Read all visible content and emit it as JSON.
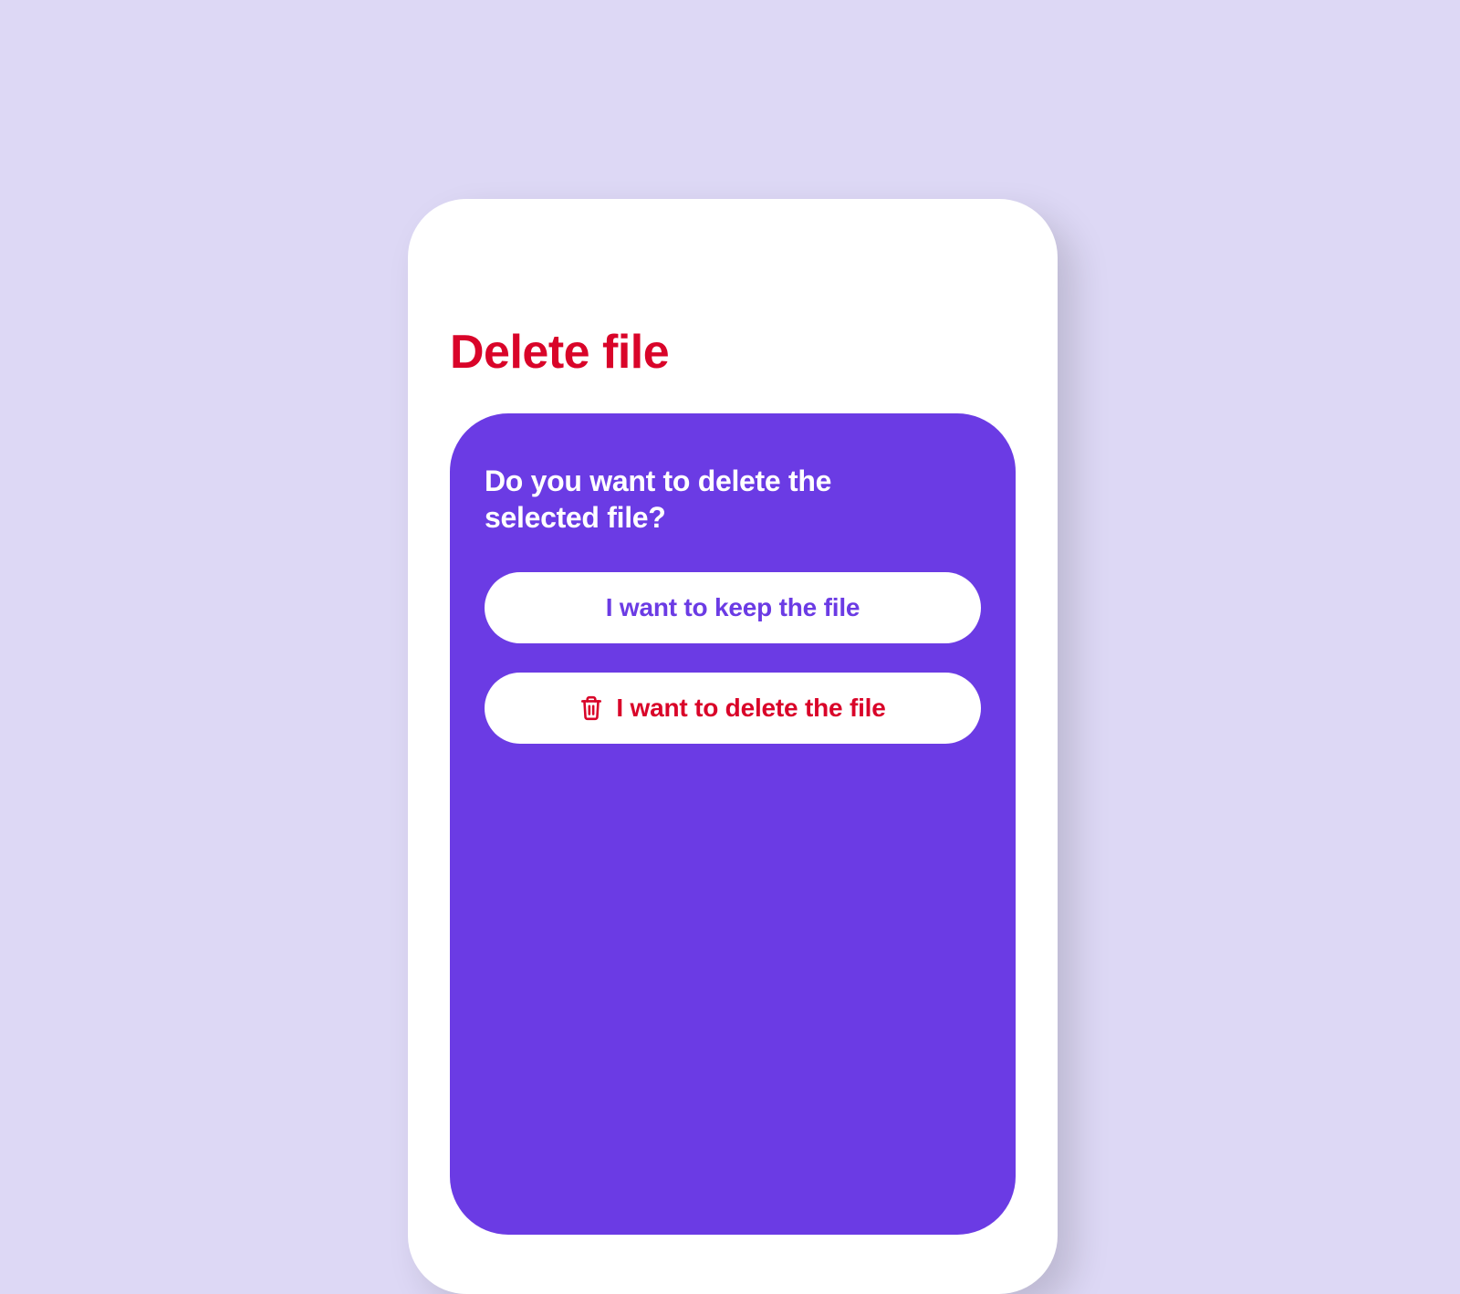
{
  "colors": {
    "background": "#DDD8F5",
    "card": "#FFFFFF",
    "panel": "#6B3BE4",
    "accent_red": "#D90429",
    "accent_purple": "#6B3BE4"
  },
  "header": {
    "title": "Delete file"
  },
  "dialog": {
    "question": "Do you want to delete the selected file?",
    "keep_label": "I want to keep the file",
    "delete_label": "I want to delete the file",
    "delete_icon": "trash-icon"
  }
}
